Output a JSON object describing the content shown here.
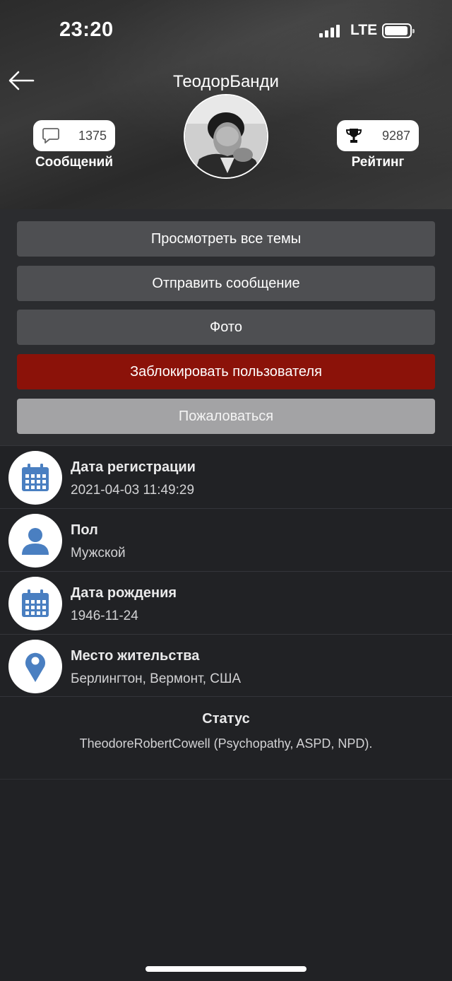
{
  "status_bar": {
    "time": "23:20",
    "network": "LTE"
  },
  "profile": {
    "username": "ТеодорБанди",
    "messages": {
      "count": "1375",
      "label": "Сообщений",
      "icon": "chat-bubble-icon"
    },
    "rating": {
      "count": "9287",
      "label": "Рейтинг",
      "icon": "trophy-icon"
    }
  },
  "actions": {
    "view_topics": "Просмотреть все темы",
    "send_message": "Отправить сообщение",
    "photo": "Фото",
    "block_user": "Заблокировать пользователя",
    "report": "Пожаловаться"
  },
  "info": [
    {
      "title": "Дата регистрации",
      "value": "2021-04-03 11:49:29",
      "icon": "calendar-icon"
    },
    {
      "title": "Пол",
      "value": "Мужской",
      "icon": "person-icon"
    },
    {
      "title": "Дата рождения",
      "value": "1946-11-24",
      "icon": "calendar-icon"
    },
    {
      "title": "Место жительства",
      "value": "Берлингтон, Вермонт, США",
      "icon": "location-pin-icon"
    }
  ],
  "status": {
    "title": "Статус",
    "text": "TheodoreRobertCowell (Psychopathy, ASPD, NPD)."
  },
  "colors": {
    "background": "#212225",
    "button_dark": "#4e4f52",
    "button_block": "#8b1209",
    "button_report": "#a3a3a5",
    "icon_blue": "#4a7fc1"
  }
}
